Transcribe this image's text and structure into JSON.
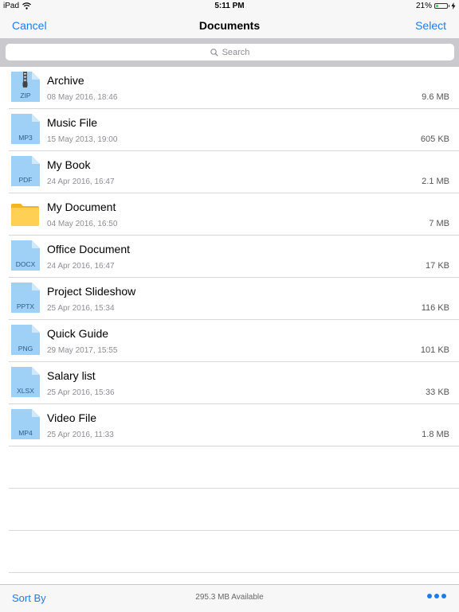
{
  "status_bar": {
    "device": "iPad",
    "time": "5:11 PM",
    "battery": "21%",
    "battery_level": 0.21
  },
  "nav": {
    "cancel_label": "Cancel",
    "title": "Documents",
    "select_label": "Select"
  },
  "search": {
    "placeholder": "Search"
  },
  "files": [
    {
      "name": "Archive",
      "date": "08 May 2016, 18:46",
      "size": "9.6 MB",
      "type": "ZIP",
      "icon": "zip-file-icon"
    },
    {
      "name": "Music File",
      "date": "15 May 2013, 19:00",
      "size": "605 KB",
      "type": "MP3",
      "icon": "file-icon"
    },
    {
      "name": "My Book",
      "date": "24 Apr 2016, 16:47",
      "size": "2.1 MB",
      "type": "PDF",
      "icon": "file-icon"
    },
    {
      "name": "My Document",
      "date": "04 May 2016, 16:50",
      "size": "7 MB",
      "type": "",
      "icon": "folder-icon"
    },
    {
      "name": "Office Document",
      "date": "24 Apr 2016, 16:47",
      "size": "17 KB",
      "type": "DOCX",
      "icon": "file-icon"
    },
    {
      "name": "Project Slideshow",
      "date": "25 Apr 2016, 15:34",
      "size": "116 KB",
      "type": "PPTX",
      "icon": "file-icon"
    },
    {
      "name": "Quick Guide",
      "date": "29 May 2017, 15:55",
      "size": "101 KB",
      "type": "PNG",
      "icon": "file-icon"
    },
    {
      "name": "Salary list",
      "date": "25 Apr 2016, 15:36",
      "size": "33 KB",
      "type": "XLSX",
      "icon": "file-icon"
    },
    {
      "name": "Video File",
      "date": "25 Apr 2016, 11:33",
      "size": "1.8 MB",
      "type": "MP4",
      "icon": "file-icon"
    }
  ],
  "toolbar": {
    "sort_label": "Sort By",
    "available": "295.3 MB Available",
    "more_icon": "more-dots-icon"
  },
  "colors": {
    "accent": "#1a7ef0",
    "file_icon": "#9fd0f5",
    "folder": "#fbc531"
  }
}
